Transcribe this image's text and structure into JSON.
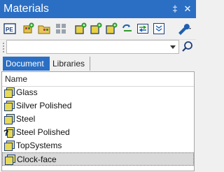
{
  "window": {
    "title": "Materials",
    "pin_glyph": "‡",
    "close_glyph": "✕",
    "accent_color": "#2b6fc4"
  },
  "toolbar": {
    "icons": [
      "pe-icon",
      "add-material-icon",
      "folder-icon",
      "grid-icon",
      "new-library-icon",
      "new-folder-icon",
      "add-library-icon",
      "refresh-icon",
      "swap-icon",
      "collapse-icon",
      "settings-wrench-icon"
    ]
  },
  "search": {
    "value": "",
    "placeholder": ""
  },
  "tabs": [
    {
      "label": "Document",
      "active": true
    },
    {
      "label": "Libraries",
      "active": false
    }
  ],
  "table": {
    "column_header": "Name",
    "rows": [
      {
        "label": "Glass",
        "icon": "material-icon",
        "selected": false
      },
      {
        "label": "Silver Polished",
        "icon": "material-icon",
        "selected": false
      },
      {
        "label": "Steel",
        "icon": "material-icon",
        "selected": false
      },
      {
        "label": "Steel Polished",
        "icon": "material-unknown-icon",
        "selected": false
      },
      {
        "label": "TopSystems",
        "icon": "material-icon",
        "selected": false
      },
      {
        "label": "Clock-face",
        "icon": "material-icon",
        "selected": true
      }
    ]
  }
}
